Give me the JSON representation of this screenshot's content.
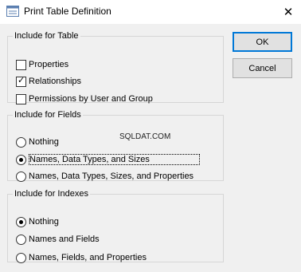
{
  "window": {
    "title": "Print Table Definition",
    "close_symbol": "✕",
    "title_icon": "table-definition-icon"
  },
  "buttons": {
    "ok_label": "OK",
    "cancel_label": "Cancel"
  },
  "include_for_table": {
    "legend": "Include for Table",
    "options": [
      {
        "label": "Properties",
        "checked": false
      },
      {
        "label": "Relationships",
        "checked": true
      },
      {
        "label": "Permissions by User and Group",
        "checked": false
      }
    ]
  },
  "include_for_fields": {
    "legend": "Include for Fields",
    "options": [
      {
        "label": "Nothing",
        "selected": false
      },
      {
        "label": "Names, Data Types, and Sizes",
        "selected": true
      },
      {
        "label": "Names, Data Types, Sizes, and Properties",
        "selected": false
      }
    ]
  },
  "include_for_indexes": {
    "legend": "Include for Indexes",
    "options": [
      {
        "label": "Nothing",
        "selected": true
      },
      {
        "label": "Names and Fields",
        "selected": false
      },
      {
        "label": "Names, Fields, and Properties",
        "selected": false
      }
    ]
  },
  "watermark": "SQLDAT.COM"
}
